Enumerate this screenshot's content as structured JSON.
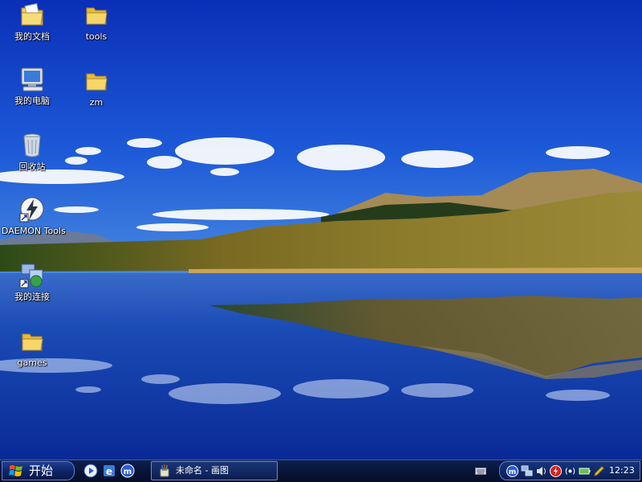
{
  "desktop": {
    "icons": [
      {
        "label": "我的文档",
        "icon": "my-documents-icon"
      },
      {
        "label": "tools",
        "icon": "folder-icon"
      },
      {
        "label": "我的电脑",
        "icon": "my-computer-icon"
      },
      {
        "label": "zm",
        "icon": "folder-icon"
      },
      {
        "label": "回收站",
        "icon": "recycle-bin-icon"
      },
      {
        "label": "DAEMON Tools",
        "icon": "daemon-tools-icon"
      },
      {
        "label": "我的连接",
        "icon": "network-connections-icon"
      },
      {
        "label": "games",
        "icon": "folder-icon"
      }
    ]
  },
  "taskbar": {
    "start_label": "开始",
    "quick_launch": [
      "media-player-icon",
      "ie-browser-icon",
      "maxthon-browser-icon"
    ],
    "tasks": [
      {
        "label": "未命名 - 画图",
        "icon": "paint-icon"
      }
    ],
    "tray": {
      "icons": [
        "keyboard-icon",
        "maxthon-tray-icon",
        "network-tray-icon",
        "volume-tray-icon",
        "antivirus-tray-icon",
        "wireless-tray-icon",
        "battery-tray-icon",
        "pencil-tray-icon"
      ],
      "clock": "12:23"
    }
  },
  "colors": {
    "sky": "#1a3fc4",
    "taskbar": "#0a1a44",
    "accent": "#5b7fd6"
  }
}
